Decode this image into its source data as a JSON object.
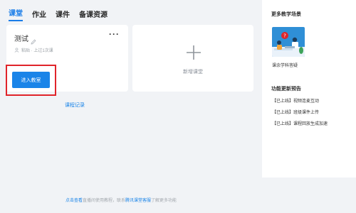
{
  "tabs": [
    {
      "label": "课堂",
      "active": true
    },
    {
      "label": "作业",
      "active": false
    },
    {
      "label": "课件",
      "active": false
    },
    {
      "label": "备课资源",
      "active": false
    }
  ],
  "class_card": {
    "name": "测试",
    "meta": "粘贴 · 上过1次课",
    "enter_button": "进入教室",
    "record_link": "课程记录"
  },
  "new_class": {
    "label": "新增课堂"
  },
  "footer": {
    "prefix_link": "点击查看",
    "middle": "直播间使用教程，联系",
    "brand_link": "腾讯课堂客服",
    "suffix": "了解更多功能"
  },
  "right_panel": {
    "scenes_title": "更多教学场景",
    "scene_label": "课余学科答疑",
    "updates_title": "功能更新预告",
    "updates": [
      "【已上线】视频连麦互动",
      "【已上线】班级课件上传",
      "【已上线】课程回放生成加速"
    ]
  },
  "colors": {
    "accent": "#1a84e8",
    "highlight": "#e0242a",
    "background": "#f1f3f6"
  }
}
